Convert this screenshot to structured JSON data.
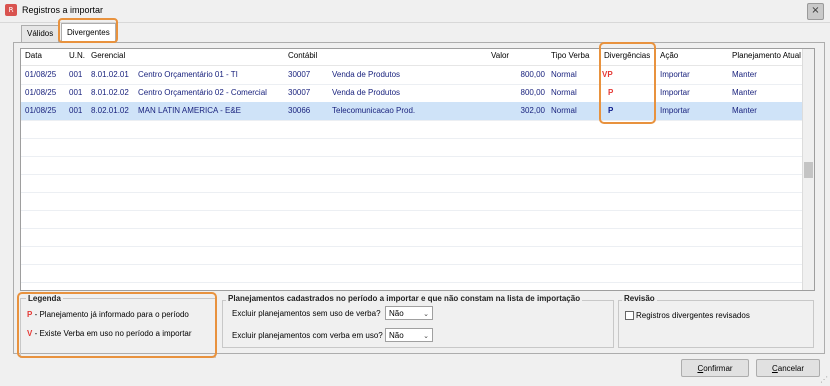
{
  "window": {
    "app_icon_text": "R",
    "title": "Registros a importar",
    "close_symbol": "×"
  },
  "tabs": [
    {
      "label": "Válidos",
      "active": false
    },
    {
      "label": "Divergentes",
      "active": true
    }
  ],
  "grid": {
    "columns": [
      "Data",
      "U.N.",
      "Gerencial",
      "Contábil",
      "Valor",
      "Tipo Verba",
      "Divergências",
      "Ação",
      "Planejamento Atual"
    ],
    "rows": [
      {
        "data": "01/08/25",
        "un": "001",
        "gerencial_code": "8.01.02.01",
        "gerencial_name": "Centro Orçamentário 01 - TI",
        "contabil_code": "30007",
        "contabil_name": "Venda de Produtos",
        "valor": "800,00",
        "tipo_verba": "Normal",
        "divergencia": "VP",
        "acao": "Importar",
        "planejamento": "Manter",
        "selected": false
      },
      {
        "data": "01/08/25",
        "un": "001",
        "gerencial_code": "8.01.02.02",
        "gerencial_name": "Centro Orçamentário 02 - Comercial",
        "contabil_code": "30007",
        "contabil_name": "Venda de Produtos",
        "valor": "800,00",
        "tipo_verba": "Normal",
        "divergencia": "P",
        "acao": "Importar",
        "planejamento": "Manter",
        "selected": false
      },
      {
        "data": "01/08/25",
        "un": "001",
        "gerencial_code": "8.02.01.02",
        "gerencial_name": "MAN LATIN AMERICA - E&E",
        "contabil_code": "30066",
        "contabil_name": "Telecomunicacao Prod.",
        "valor": "302,00",
        "tipo_verba": "Normal",
        "divergencia": "P",
        "acao": "Importar",
        "planejamento": "Manter",
        "selected": true
      }
    ]
  },
  "legend": {
    "title": "Legenda",
    "items": [
      {
        "key": "P",
        "text": " - Planejamento já informado para o período"
      },
      {
        "key": "V",
        "text": " - Existe Verba em uso no período a importar"
      }
    ]
  },
  "planejamentos": {
    "title": "Planejamentos cadastrados no período a importar e que não constam na lista de importação",
    "excluir_sem_verba_label": "Excluir planejamentos sem uso de verba?",
    "excluir_sem_verba_value": "Não",
    "excluir_com_verba_label": "Excluir planejamentos com verba em uso?",
    "excluir_com_verba_value": "Não"
  },
  "revisao": {
    "title": "Revisão",
    "checkbox_label": "Registros divergentes revisados",
    "checked": false
  },
  "buttons": {
    "confirmar_prefix": "C",
    "confirmar_rest": "onfirmar",
    "cancelar_prefix": "C",
    "cancelar_rest": "ancelar"
  },
  "icons": {
    "dropdown_arrow": "⌄",
    "resize_grip": "⋰"
  },
  "colors": {
    "highlight": "#e8923e",
    "selected_row": "#cfe3f8",
    "divergence_text": "#e53935",
    "grid_text": "#1a237e"
  }
}
